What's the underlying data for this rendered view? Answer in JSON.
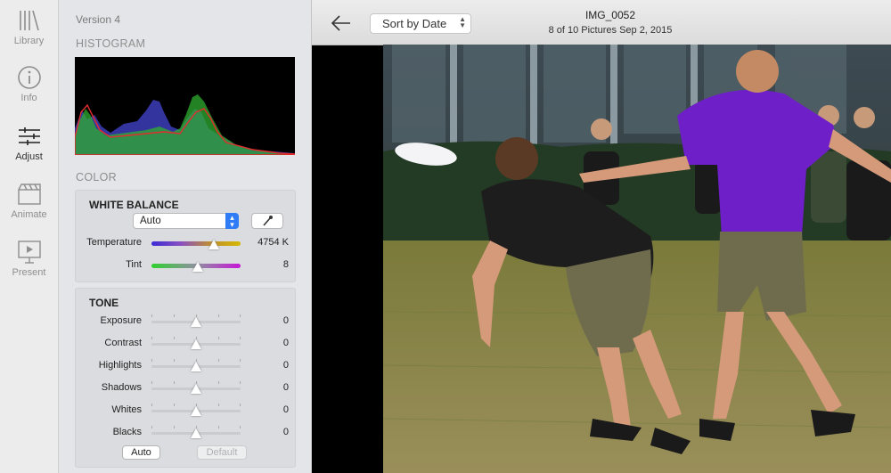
{
  "rail": {
    "items": [
      {
        "label": "Library",
        "icon": "library-icon"
      },
      {
        "label": "Info",
        "icon": "info-icon"
      },
      {
        "label": "Adjust",
        "icon": "sliders-icon"
      },
      {
        "label": "Animate",
        "icon": "clapper-icon"
      },
      {
        "label": "Present",
        "icon": "present-icon"
      }
    ]
  },
  "panel": {
    "version": "Version 4",
    "histogram_title": "HISTOGRAM",
    "color_title": "COLOR",
    "white_balance": {
      "title": "WHITE BALANCE",
      "mode": "Auto",
      "temperature_label": "Temperature",
      "temperature_value": "4754 K",
      "temperature_level": 0.7,
      "tint_label": "Tint",
      "tint_value": "8",
      "tint_level": 0.52
    },
    "tone": {
      "title": "TONE",
      "rows": [
        {
          "label": "Exposure",
          "value": "0"
        },
        {
          "label": "Contrast",
          "value": "0"
        },
        {
          "label": "Highlights",
          "value": "0"
        },
        {
          "label": "Shadows",
          "value": "0"
        },
        {
          "label": "Whites",
          "value": "0"
        },
        {
          "label": "Blacks",
          "value": "0"
        }
      ],
      "auto_label": "Auto",
      "default_label": "Default"
    }
  },
  "viewer": {
    "sort_label": "Sort by Date",
    "image_name": "IMG_0052",
    "image_info": "8 of 10 Pictures  Sep 2, 2015"
  },
  "colors": {
    "accent": "#2f7cf6",
    "temperature_gradient": [
      "#3b2bd6",
      "#d4b800"
    ],
    "tint_gradient": [
      "#2fd02f",
      "#c618d6"
    ]
  }
}
